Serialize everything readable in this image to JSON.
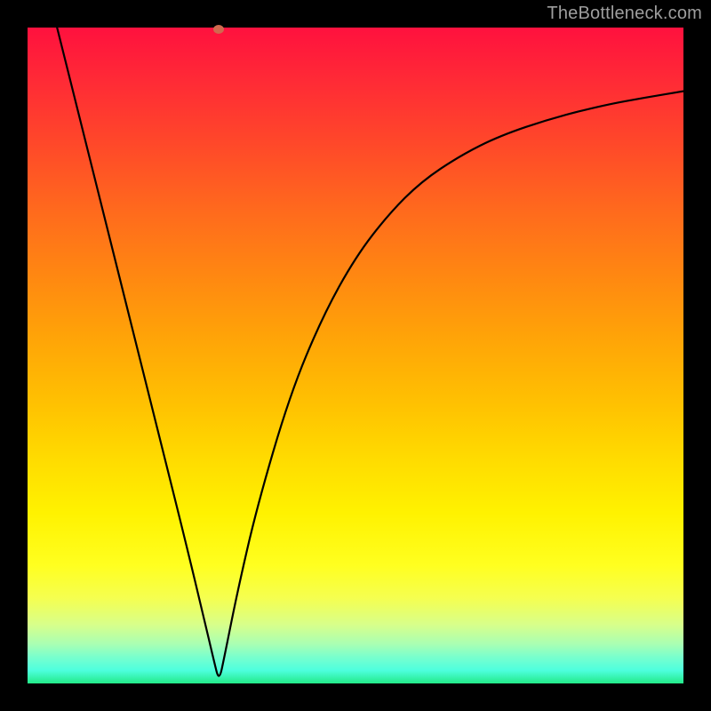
{
  "watermark": "TheBottleneck.com",
  "marker": {
    "x_frac": 0.292,
    "y_frac": 0.997
  },
  "chart_data": {
    "type": "line",
    "title": "",
    "xlabel": "",
    "ylabel": "",
    "xlim": [
      0,
      1
    ],
    "ylim": [
      0,
      1
    ],
    "grid": false,
    "series": [
      {
        "name": "curve",
        "x": [
          0.045,
          0.08,
          0.12,
          0.16,
          0.2,
          0.24,
          0.27,
          0.284,
          0.292,
          0.3,
          0.32,
          0.35,
          0.4,
          0.45,
          0.5,
          0.55,
          0.6,
          0.66,
          0.72,
          0.8,
          0.88,
          0.94,
          1.0
        ],
        "y": [
          1.0,
          0.86,
          0.7,
          0.54,
          0.38,
          0.22,
          0.095,
          0.035,
          0.003,
          0.04,
          0.14,
          0.27,
          0.44,
          0.56,
          0.65,
          0.715,
          0.765,
          0.805,
          0.835,
          0.862,
          0.882,
          0.893,
          0.903
        ]
      }
    ],
    "background_gradient": {
      "direction": "top-to-bottom",
      "stops": [
        {
          "pos": 0.0,
          "color": "#ff113e"
        },
        {
          "pos": 0.5,
          "color": "#ffae05"
        },
        {
          "pos": 0.8,
          "color": "#ffff20"
        },
        {
          "pos": 1.0,
          "color": "#22ea88"
        }
      ]
    }
  }
}
